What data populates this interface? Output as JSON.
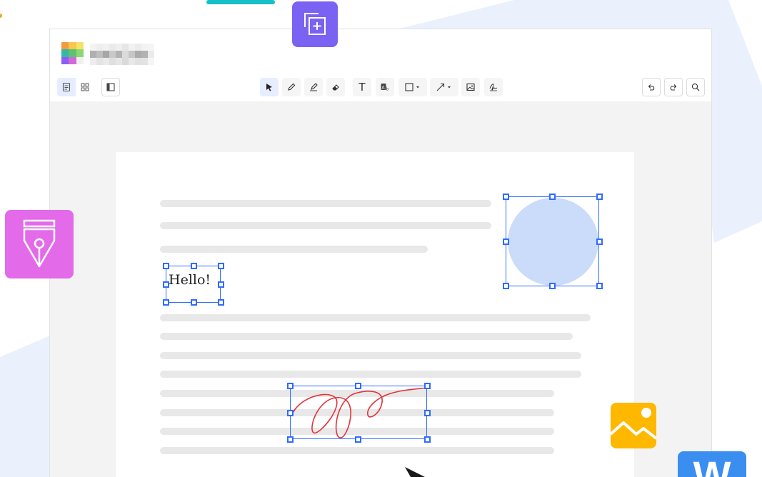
{
  "app": {
    "window_title": ""
  },
  "toolbar": {
    "left_tools": [
      {
        "name": "single-page-view",
        "icon": "page-icon"
      },
      {
        "name": "grid-view",
        "icon": "grid-icon"
      },
      {
        "name": "sidebar-toggle",
        "icon": "sidebar-icon"
      }
    ],
    "center_tools": [
      {
        "name": "select",
        "icon": "cursor-icon"
      },
      {
        "name": "pen",
        "icon": "pen-icon"
      },
      {
        "name": "highlighter",
        "icon": "highlighter-icon"
      },
      {
        "name": "eraser",
        "icon": "eraser-icon"
      },
      {
        "name": "text",
        "icon": "text-icon",
        "label": "T"
      },
      {
        "name": "ocr",
        "icon": "text-recognition-icon"
      },
      {
        "name": "shape",
        "icon": "rectangle-icon"
      },
      {
        "name": "arrow",
        "icon": "arrow-icon"
      },
      {
        "name": "image",
        "icon": "image-icon"
      },
      {
        "name": "signature",
        "icon": "signature-icon"
      }
    ],
    "right_tools": [
      {
        "name": "undo",
        "icon": "undo-icon"
      },
      {
        "name": "redo",
        "icon": "redo-icon"
      },
      {
        "name": "search",
        "icon": "search-icon"
      }
    ]
  },
  "document": {
    "text_annotation": "Hello!"
  },
  "colors": {
    "accent": "#2f6bff",
    "circle_fill": "#cbdcfb",
    "signature": "#e5313a",
    "pen_tile": "#e36ae9",
    "copy_tile": "#7a63f2",
    "image_tile": "#ffb800",
    "word_tile": "#3a8ef0"
  },
  "floating_icons": [
    {
      "name": "copy-add-icon"
    },
    {
      "name": "pen-nib-icon"
    },
    {
      "name": "image-icon"
    },
    {
      "name": "word-icon",
      "label": "W"
    }
  ]
}
